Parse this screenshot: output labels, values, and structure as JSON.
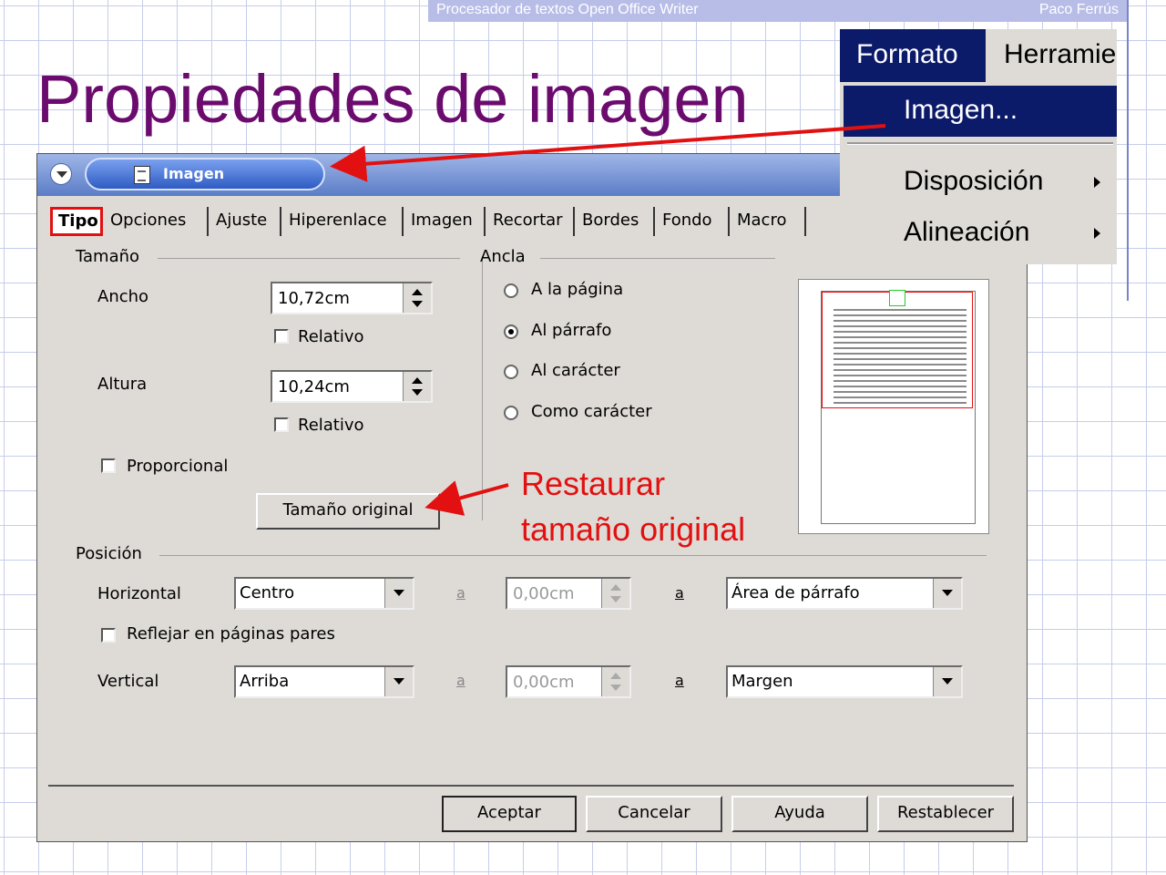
{
  "header": {
    "left": "Procesador de textos Open Office Writer",
    "right": "Paco Ferrús"
  },
  "slide_title": "Propiedades de imagen",
  "dialog": {
    "title": "Imagen",
    "tabs": [
      "Tipo",
      "Opciones",
      "Ajuste",
      "Hiperenlace",
      "Imagen",
      "Recortar",
      "Bordes",
      "Fondo",
      "Macro"
    ],
    "tamano": {
      "group": "Tamaño",
      "ancho_label": "Ancho",
      "ancho_value": "10,72cm",
      "relativo1": "Relativo",
      "altura_label": "Altura",
      "altura_value": "10,24cm",
      "relativo2": "Relativo",
      "proporcional": "Proporcional",
      "original_button": "Tamaño original"
    },
    "ancla": {
      "group": "Ancla",
      "options": [
        "A la página",
        "Al párrafo",
        "Al carácter",
        "Como carácter"
      ]
    },
    "posicion": {
      "group": "Posición",
      "horizontal_label": "Horizontal",
      "horizontal_value": "Centro",
      "a": "a",
      "h_offset": "0,00cm",
      "h_ref": "Área de párrafo",
      "reflejar": "Reflejar en páginas pares",
      "vertical_label": "Vertical",
      "vertical_value": "Arriba",
      "v_offset": "0,00cm",
      "v_ref": "Margen"
    },
    "buttons": {
      "ok": "Aceptar",
      "cancel": "Cancelar",
      "help": "Ayuda",
      "reset": "Restablecer"
    }
  },
  "menu": {
    "bar": {
      "formato": "Formato",
      "herramientas": "Herramie"
    },
    "items": [
      "Imagen...",
      "Disposición",
      "Alineación"
    ]
  },
  "callout": {
    "line1": "Restaurar",
    "line2": "tamaño original"
  },
  "colors": {
    "title": "#6b0b6e",
    "callout": "#e21010",
    "menu_selected": "#0c1a6a"
  }
}
